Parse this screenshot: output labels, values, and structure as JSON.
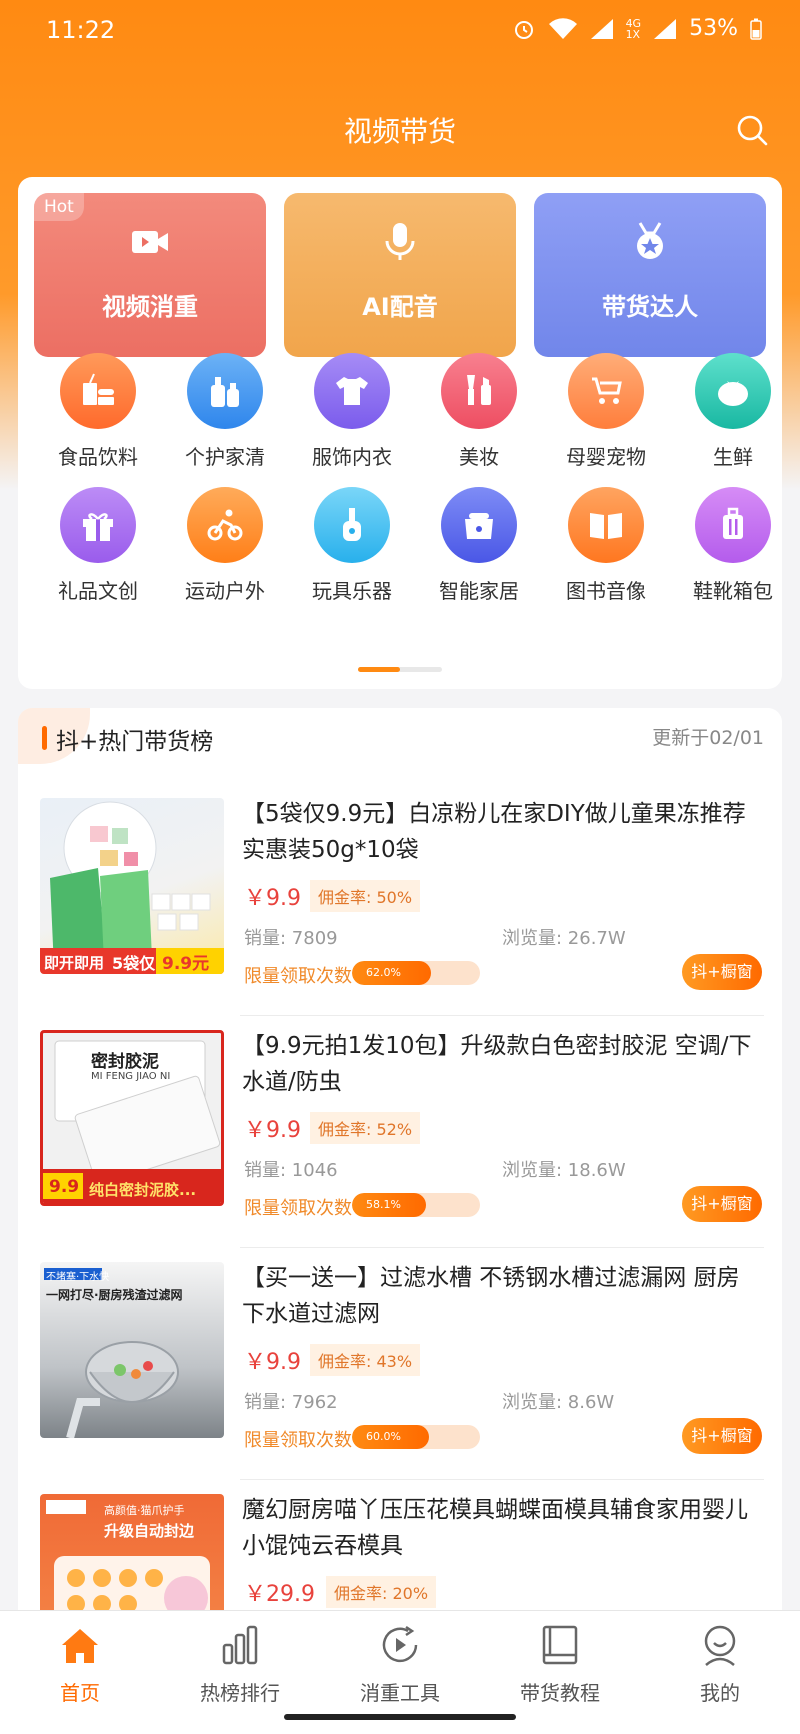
{
  "status": {
    "time": "11:22",
    "network": "4G\n1X",
    "battery": "53%"
  },
  "header": {
    "title": "视频带货"
  },
  "features": [
    {
      "label": "视频消重",
      "badge": "Hot",
      "icon": "video-camera-icon"
    },
    {
      "label": "AI配音",
      "icon": "microphone-icon"
    },
    {
      "label": "带货达人",
      "icon": "medal-icon"
    }
  ],
  "categories": [
    {
      "label": "食品饮料",
      "icon": "food-drink-icon",
      "color": "#ff7a3c"
    },
    {
      "label": "个护家清",
      "icon": "personal-care-icon",
      "color": "#3f96f0"
    },
    {
      "label": "服饰内衣",
      "icon": "clothing-icon",
      "color": "#8e6cf0"
    },
    {
      "label": "美妆",
      "icon": "makeup-icon",
      "color": "#f05f71"
    },
    {
      "label": "母婴宠物",
      "icon": "baby-stroller-icon",
      "color": "#ff8a4c"
    },
    {
      "label": "生鲜",
      "icon": "tomato-icon",
      "color": "#2fc9b4"
    },
    {
      "label": "礼品文创",
      "icon": "gift-icon",
      "color": "#a76bf0"
    },
    {
      "label": "运动户外",
      "icon": "cycling-icon",
      "color": "#ff8e32"
    },
    {
      "label": "玩具乐器",
      "icon": "guitar-icon",
      "color": "#42bff0"
    },
    {
      "label": "智能家居",
      "icon": "rice-cooker-icon",
      "color": "#5a6cf0"
    },
    {
      "label": "图书音像",
      "icon": "book-icon",
      "color": "#ff7f30"
    },
    {
      "label": "鞋靴箱包",
      "icon": "luggage-icon",
      "color": "#c16cf0"
    }
  ],
  "hotlist": {
    "title": "抖+热门带货榜",
    "updated": "更新于02/01",
    "items": [
      {
        "title": "【5袋仅9.9元】白凉粉儿在家DIY做儿童果冻推荐实惠装50g*10袋",
        "price": "￥9.9",
        "commission": "佣金率: 50%",
        "sales": "销量: 7809",
        "views": "浏览量: 26.7W",
        "limit_label": "限量领取次数",
        "progress": "62.0%",
        "progress_value": 62.0,
        "button": "抖+橱窗",
        "thumb": {
          "top": "即开即用",
          "tag": "5袋仅",
          "price": "9.9元"
        }
      },
      {
        "title": "【9.9元拍1发10包】升级款白色密封胶泥 空调/下水道/防虫",
        "price": "￥9.9",
        "commission": "佣金率: 52%",
        "sales": "销量: 1046",
        "views": "浏览量: 18.6W",
        "limit_label": "限量领取次数",
        "progress": "58.1%",
        "progress_value": 58.1,
        "button": "抖+橱窗",
        "thumb": {
          "top": "密封胶泥",
          "sub": "MI FENG JIAO NI",
          "tag": "9.9",
          "banner": "纯白密封泥胶..."
        }
      },
      {
        "title": "【买一送一】过滤水槽 不锈钢水槽过滤漏网 厨房下水道过滤网",
        "price": "￥9.9",
        "commission": "佣金率: 43%",
        "sales": "销量: 7962",
        "views": "浏览量: 8.6W",
        "limit_label": "限量领取次数",
        "progress": "60.0%",
        "progress_value": 60.0,
        "button": "抖+橱窗",
        "thumb": {
          "top": "不堵塞·下水快",
          "sub": "一网打尽·厨房残渣过滤网"
        }
      },
      {
        "title": "魔幻厨房喵丫压压花模具蝴蝶面模具辅食家用婴儿小馄饨云吞模具",
        "price": "￥29.9",
        "commission": "佣金率: 20%",
        "thumb": {
          "top": "高颜值·猫爪护手",
          "sub": "升级自动封边"
        }
      }
    ]
  },
  "tabs": [
    {
      "label": "首页",
      "icon": "home-icon",
      "active": true
    },
    {
      "label": "热榜排行",
      "icon": "bar-chart-icon"
    },
    {
      "label": "消重工具",
      "icon": "refresh-play-icon"
    },
    {
      "label": "带货教程",
      "icon": "book-tutorial-icon"
    },
    {
      "label": "我的",
      "icon": "profile-icon"
    }
  ],
  "colors": {
    "accent": "#ff6a00",
    "price": "#e8423c"
  }
}
